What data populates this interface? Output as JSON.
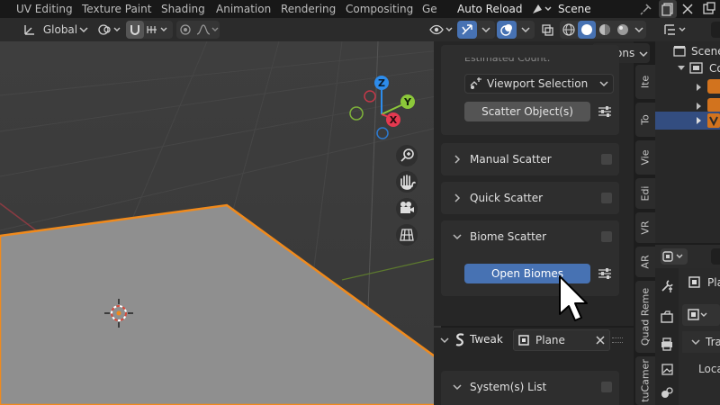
{
  "topbar": {
    "tabs": [
      "UV Editing",
      "Texture Paint",
      "Shading",
      "Animation",
      "Rendering",
      "Compositing",
      "Ge"
    ],
    "auto_reload": "Auto Reload",
    "scene": "Scene"
  },
  "viewport_header": {
    "orientation": "Global",
    "options_label": "Options"
  },
  "gizmo": {
    "z": "Z",
    "y": "Y",
    "x": "X"
  },
  "npanel": {
    "estimated_count_label": "Estimated Count:",
    "selection_dropdown": "Viewport Selection",
    "scatter_objects_button": "Scatter Object(s)",
    "panels": [
      {
        "title": "Manual Scatter"
      },
      {
        "title": "Quick Scatter"
      },
      {
        "title": "Biome Scatter"
      }
    ],
    "open_biomes_button": "Open Biomes"
  },
  "vertical_tabs": [
    "Ite",
    "To",
    "Vie",
    "Edi",
    "VR",
    "AR",
    "Quad Reme",
    "tuCamer"
  ],
  "tweak": {
    "title": "Tweak",
    "object_name": "Plane",
    "systems_list": "System(s) List"
  },
  "outliner": {
    "root": "Scene",
    "collection": "Co"
  },
  "properties": {
    "object_name": "Pla",
    "transform": "Tra",
    "location": "Loca"
  },
  "colors": {
    "accent_blue": "#4772b3",
    "selection_orange": "#f08a1c",
    "axis_x": "#e53950",
    "axis_y": "#8cc83a",
    "axis_z": "#2d8ceb"
  }
}
